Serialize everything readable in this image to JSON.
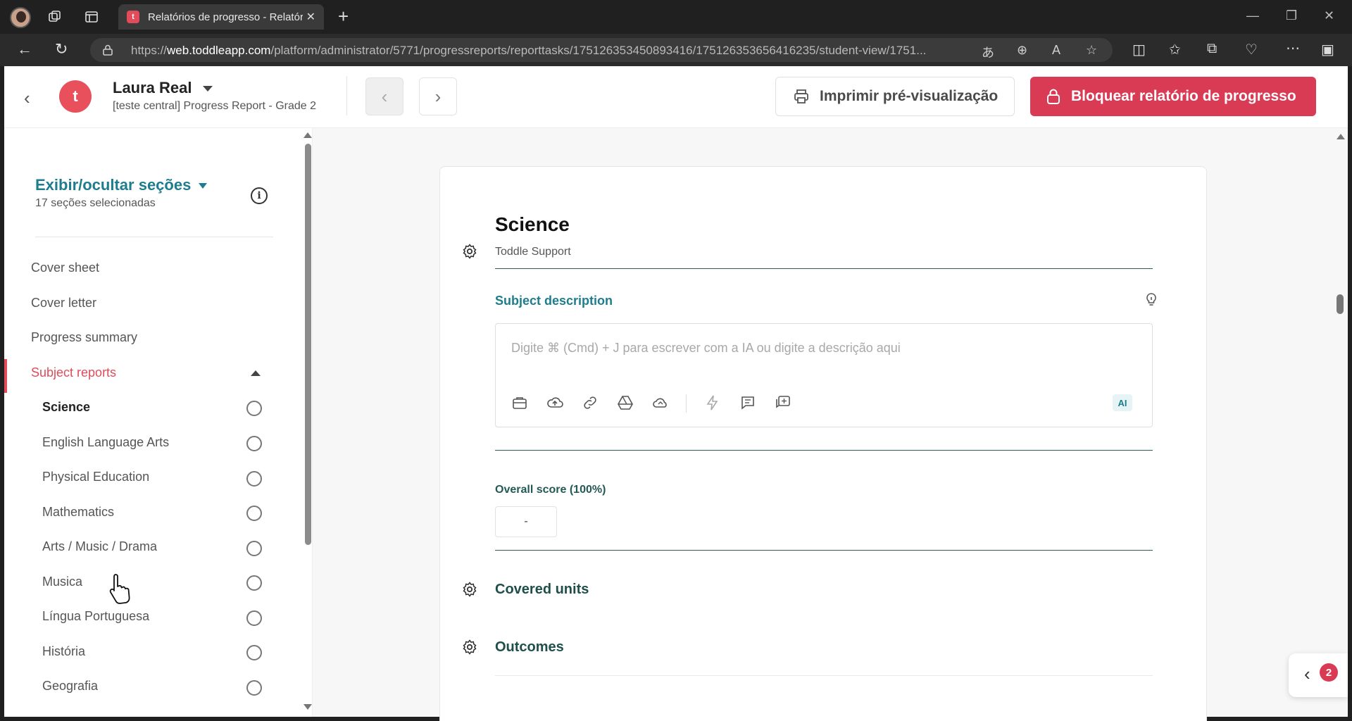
{
  "browser": {
    "tab_title": "Relatórios de progresso - Relatórios",
    "tab_favicon_letter": "t",
    "url_prefix": "https://",
    "url_host": "web.toddleapp.com",
    "url_path": "/platform/administrator/5771/progressreports/reporttasks/175126353450893416/175126353656416235/student-view/1751..."
  },
  "header": {
    "logo_letter": "t",
    "student_name": "Laura Real",
    "report_name": "[teste central] Progress Report - Grade 2",
    "print_label": "Imprimir pré-visualização",
    "lock_label": "Bloquear relatório de progresso"
  },
  "sidebar": {
    "toggle_label": "Exibir/ocultar seções",
    "selected_count": "17 seções selecionadas",
    "items": [
      {
        "label": "Cover sheet"
      },
      {
        "label": "Cover letter"
      },
      {
        "label": "Progress summary"
      },
      {
        "label": "Subject reports"
      }
    ],
    "subjects": [
      {
        "label": "Science"
      },
      {
        "label": "English Language Arts"
      },
      {
        "label": "Physical Education"
      },
      {
        "label": "Mathematics"
      },
      {
        "label": "Arts / Music / Drama"
      },
      {
        "label": "Musica"
      },
      {
        "label": "Língua Portuguesa"
      },
      {
        "label": "História"
      },
      {
        "label": "Geografia"
      }
    ]
  },
  "main": {
    "section_title": "Science",
    "section_author": "Toddle Support",
    "subject_description_label": "Subject description",
    "editor_placeholder": "Digite ⌘ (Cmd) + J para escrever com a IA ou digite a descrição aqui",
    "ai_badge": "AI",
    "overall_score_label": "Overall score (100%)",
    "overall_score_value": "-",
    "covered_units_label": "Covered units",
    "outcomes_label": "Outcomes",
    "notification_count": "2"
  },
  "colors": {
    "brand_red": "#d93b55",
    "teal": "#1e7d8c",
    "dark_teal": "#1f4f4a"
  }
}
